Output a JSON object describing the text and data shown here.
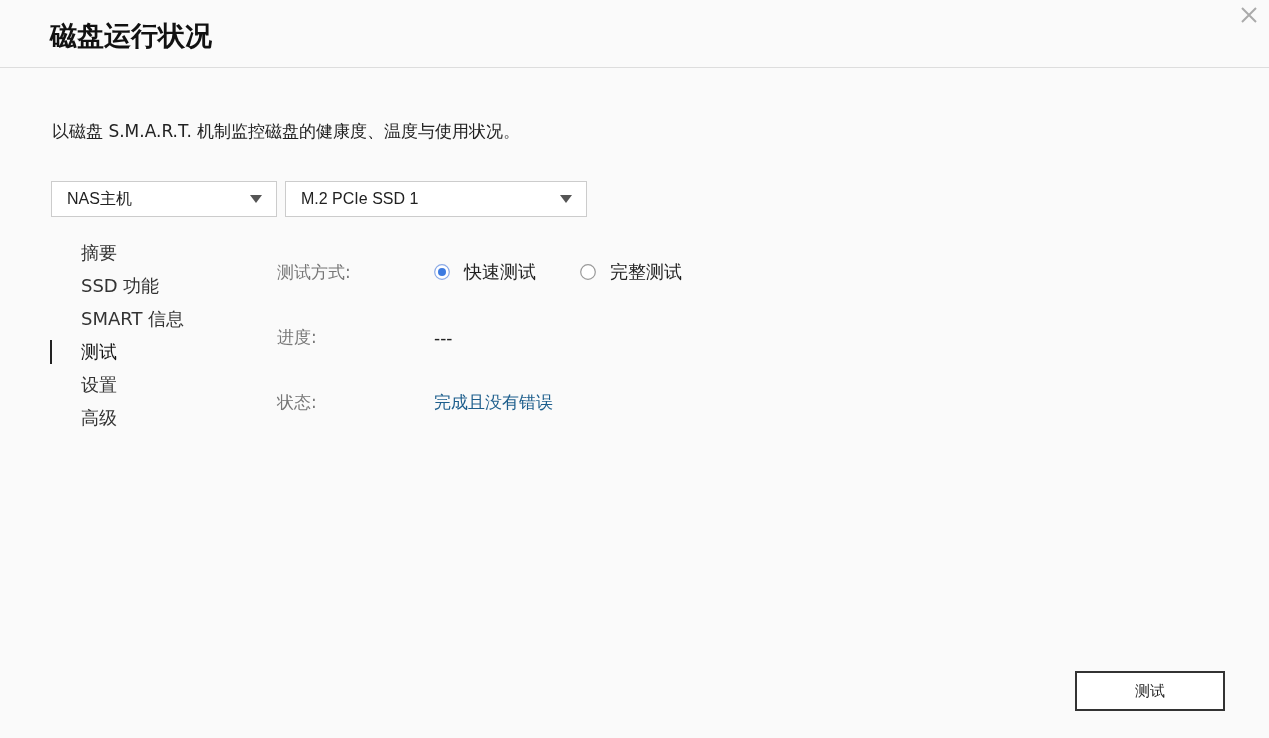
{
  "window": {
    "title": "磁盘运行状况"
  },
  "description": "以磁盘 S.M.A.R.T. 机制监控磁盘的健康度、温度与使用状况。",
  "selectors": [
    {
      "value": "NAS主机"
    },
    {
      "value": "M.2 PCIe SSD 1"
    }
  ],
  "sidebar": {
    "items": [
      {
        "label": "摘要",
        "selected": false
      },
      {
        "label": "SSD 功能",
        "selected": false
      },
      {
        "label": "SMART 信息",
        "selected": false
      },
      {
        "label": "测试",
        "selected": true
      },
      {
        "label": "设置",
        "selected": false
      },
      {
        "label": "高级",
        "selected": false
      }
    ]
  },
  "test_form": {
    "method_label": "测试方式:",
    "methods": [
      {
        "label": "快速测试",
        "selected": true
      },
      {
        "label": "完整测试",
        "selected": false
      }
    ],
    "progress_label": "进度:",
    "progress_value": "---",
    "status_label": "状态:",
    "status_value": "完成且没有错误"
  },
  "buttons": [
    "测试"
  ]
}
